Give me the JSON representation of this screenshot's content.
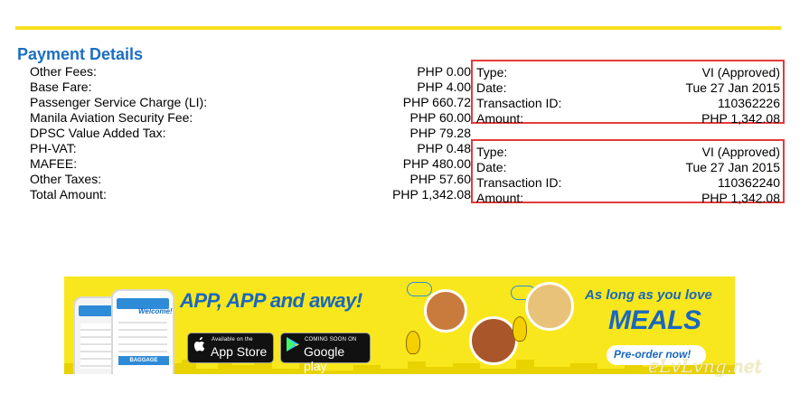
{
  "payment": {
    "title": "Payment Details",
    "fees": [
      {
        "label": "Other Fees:",
        "value": "PHP 0.00"
      },
      {
        "label": "Base Fare:",
        "value": "PHP 4.00"
      },
      {
        "label": "Passenger Service Charge (LI):",
        "value": "PHP 660.72"
      },
      {
        "label": "Manila Aviation Security Fee:",
        "value": "PHP 60.00"
      },
      {
        "label": "DPSC Value Added Tax:",
        "value": "PHP 79.28"
      },
      {
        "label": "PH-VAT:",
        "value": "PHP 0.48"
      },
      {
        "label": "MAFEE:",
        "value": "PHP 480.00"
      },
      {
        "label": "Other Taxes:",
        "value": "PHP 57.60"
      },
      {
        "label": "Total Amount:",
        "value": "PHP 1,342.08"
      }
    ],
    "transactions": [
      {
        "type_label": "Type:",
        "type_value": "VI (Approved)",
        "date_label": "Date:",
        "date_value": "Tue 27 Jan 2015",
        "id_label": "Transaction ID:",
        "id_value": "110362226",
        "amount_label": "Amount:",
        "amount_value": "PHP 1,342.08"
      },
      {
        "type_label": "Type:",
        "type_value": "VI (Approved)",
        "date_label": "Date:",
        "date_value": "Tue 27 Jan 2015",
        "id_label": "Transaction ID:",
        "id_value": "110362240",
        "amount_label": "Amount:",
        "amount_value": "PHP 1,342.08"
      }
    ]
  },
  "banner": {
    "app_slogan": "APP, APP and away!",
    "app_store_small": "Available on the",
    "app_store_big": "App Store",
    "google_small": "COMING SOON ON",
    "google_big": "Google play",
    "phone_welcome": "Welcome!",
    "phone_baggage": "BAGGAGE",
    "love_text": "As long as you love",
    "meals_text": "MEALS",
    "preorder_text": "Pre-order now!"
  },
  "watermark": "eLvLvng.net",
  "colors": {
    "accent_blue": "#1b6ec2",
    "highlight_red": "#e33b3b",
    "brand_yellow": "#f7e11e"
  },
  "icons": {
    "apple": "apple-icon",
    "google_play": "google-play-icon"
  }
}
